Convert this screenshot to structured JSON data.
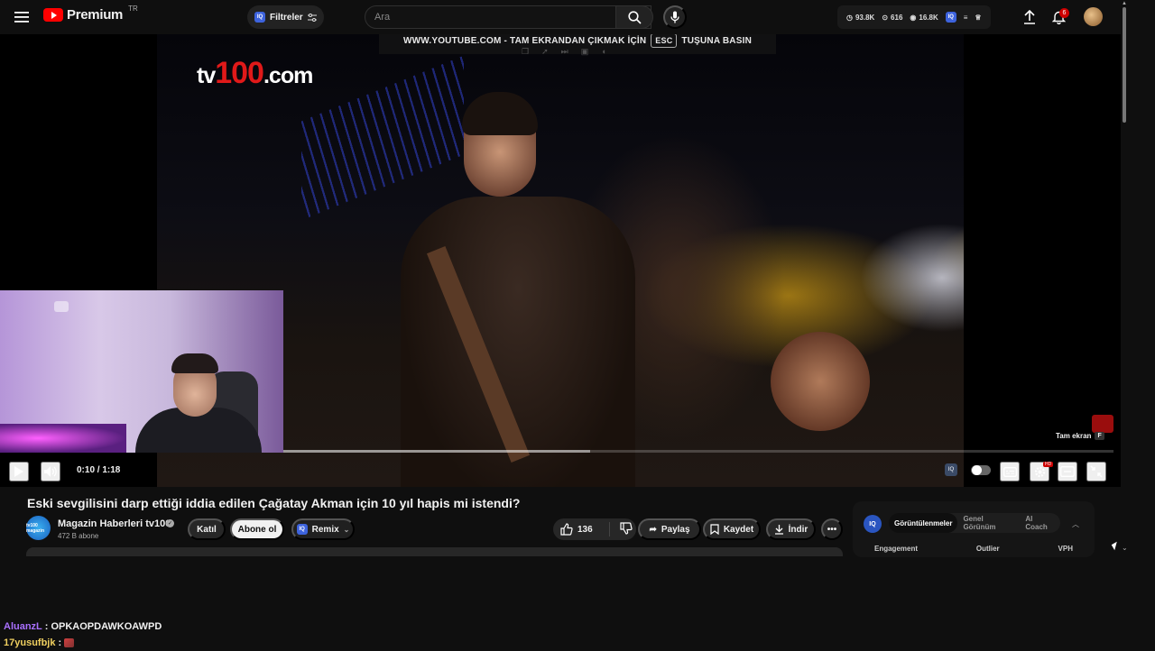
{
  "topbar": {
    "logo_text": "Premium",
    "country_code": "TR",
    "filters_label": "Filtreler",
    "search_placeholder": "Ara",
    "stats": [
      {
        "icon": "clock-icon",
        "value": "93.8K"
      },
      {
        "icon": "users-icon",
        "value": "616"
      },
      {
        "icon": "eye-icon",
        "value": "16.8K"
      }
    ],
    "notification_count": "6"
  },
  "player": {
    "watermark": "tv100.com",
    "fullscreen_hint_prefix": "WWW.YOUTUBE.COM - TAM EKRANDAN ÇIKMAK İÇİN",
    "fullscreen_hint_key": "ESC",
    "fullscreen_hint_suffix": "TUŞUNA BASIN",
    "fullscreen_tip": "Tam ekran",
    "fullscreen_tip_key": "F",
    "time": "0:10 / 1:18",
    "progress_fraction": 0.13,
    "buffer_fraction": 0.37
  },
  "video": {
    "title": "Eski sevgilisini darp ettiği iddia edilen Çağatay Akman için 10 yıl hapis mi istendi?",
    "channel_name": "Magazin Haberleri tv100",
    "channel_avatar_text": "tv100 magazin",
    "subscribers": "472 B abone",
    "join_label": "Katıl",
    "subscribe_label": "Abone ol",
    "remix_label": "Remix",
    "like_count": "136",
    "share_label": "Paylaş",
    "save_label": "Kaydet",
    "download_label": "İndir"
  },
  "side_panel": {
    "tabs": [
      "Görüntülenmeler",
      "Genel Görünüm",
      "AI Coach"
    ],
    "active_tab": "Görüntülenmeler",
    "columns": [
      "Engagement",
      "Outlier",
      "VPH"
    ]
  },
  "chat": [
    {
      "user": "AluanzL",
      "message": "OPKAOPDAWKOAWPD",
      "color": "#a970ff"
    },
    {
      "user": "17yusufbjk",
      "message": "",
      "color": "#f0d060"
    }
  ],
  "colors": {
    "brand_red": "#ff0000",
    "background": "#0f0f0f",
    "iq_blue": "#3d63dd"
  }
}
